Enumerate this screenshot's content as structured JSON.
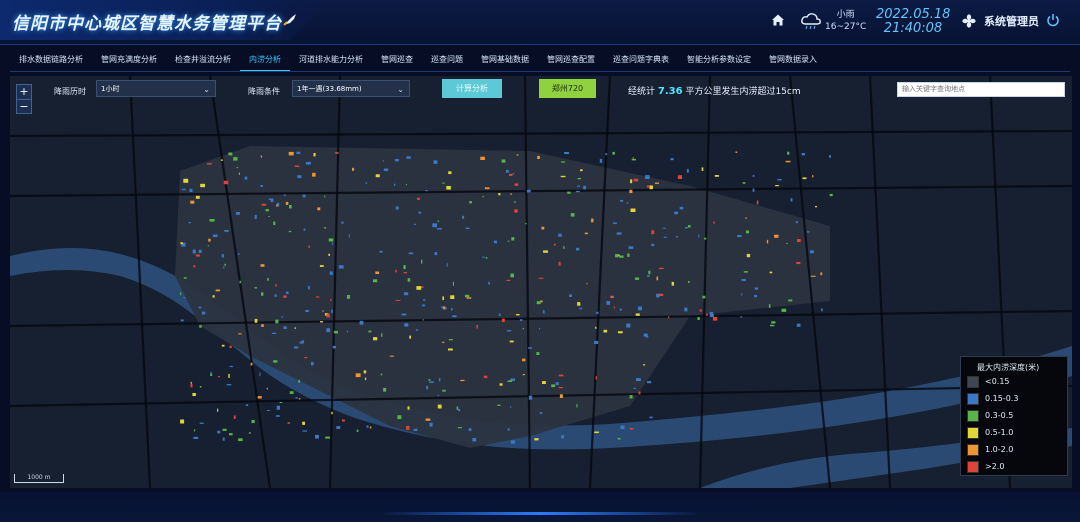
{
  "header": {
    "title": "信阳市中心城区智慧水务管理平台",
    "weather": {
      "condition": "小雨",
      "temp": "16~27°C"
    },
    "date": "2022.05.18",
    "time": "21:40:08",
    "user": "系统管理员"
  },
  "nav": {
    "items": [
      "排水数据链路分析",
      "管网充满度分析",
      "检查井溢流分析",
      "内涝分析",
      "河道排水能力分析",
      "管网巡查",
      "巡查问题",
      "管网基础数据",
      "管网巡查配置",
      "巡查问题字典表",
      "智能分析参数设定",
      "管网数据录入"
    ],
    "active": "内涝分析"
  },
  "controls": {
    "duration_label": "降雨历时",
    "duration_value": "1小时",
    "condition_label": "降雨条件",
    "condition_value": "1年一遇(33.68mm)",
    "calc_button": "计算分析",
    "rain_button": "郑州720",
    "stat_prefix": "经统计",
    "stat_value": "7.36",
    "stat_suffix": "平方公里发生内涝超过15cm",
    "search_placeholder": "输入关键字查询地点"
  },
  "map": {
    "zoom_in": "+",
    "zoom_out": "−",
    "scale_label": "1000 m"
  },
  "legend": {
    "title": "最大内涝深度(米)",
    "items": [
      {
        "label": "<0.15",
        "color": "#3d4652"
      },
      {
        "label": "0.15-0.3",
        "color": "#3b79c7"
      },
      {
        "label": "0.3-0.5",
        "color": "#56b448"
      },
      {
        "label": "0.5-1.0",
        "color": "#e3d43a"
      },
      {
        "label": "1.0-2.0",
        "color": "#ee9433"
      },
      {
        "label": ">2.0",
        "color": "#e04339"
      }
    ]
  },
  "icons": {
    "home": "home-icon",
    "weather": "cloud-rain-icon",
    "system": "fan-icon",
    "power": "power-icon"
  }
}
